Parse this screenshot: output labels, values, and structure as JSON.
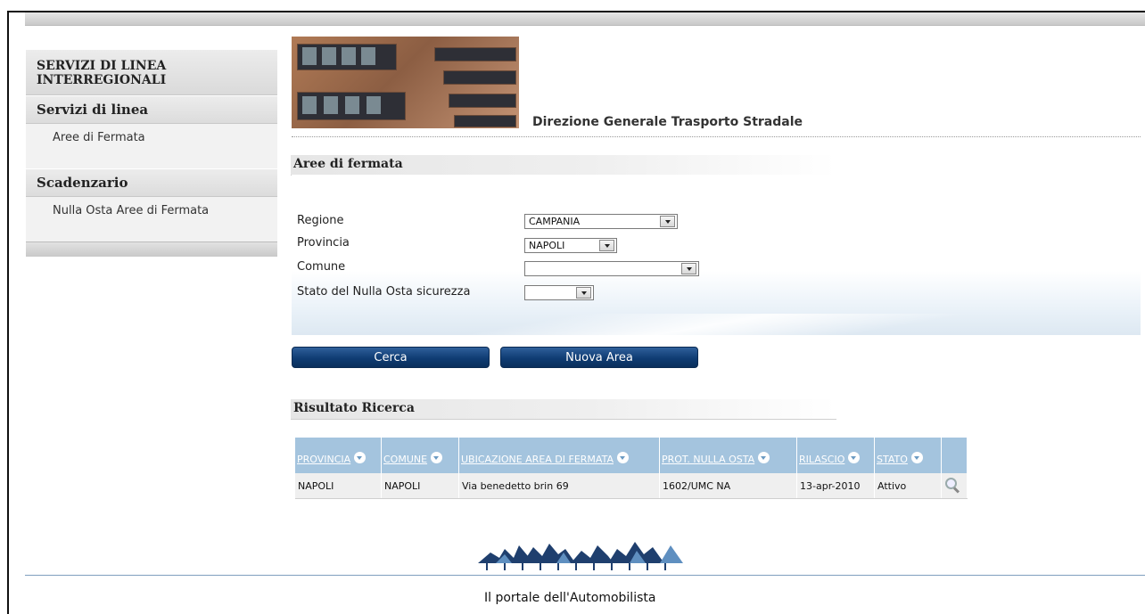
{
  "sidebar": {
    "title": "SERVIZI DI LINEA INTERREGIONALI",
    "sections": [
      {
        "heading": "Servizi di linea",
        "items": [
          "Aree di Fermata"
        ]
      },
      {
        "heading": "Scadenzario",
        "items": [
          "Nulla Osta Aree di Fermata"
        ]
      }
    ]
  },
  "header": {
    "department": "Direzione Generale Trasporto Stradale"
  },
  "search_section": {
    "title": "Aree di fermata"
  },
  "form": {
    "regione_label": "Regione",
    "regione_value": "CAMPANIA",
    "provincia_label": "Provincia",
    "provincia_value": "NAPOLI",
    "comune_label": "Comune",
    "comune_value": "",
    "stato_label": "Stato del Nulla Osta sicurezza",
    "stato_value": ""
  },
  "buttons": {
    "search": "Cerca",
    "new_area": "Nuova Area"
  },
  "results": {
    "title": "Risultato Ricerca",
    "columns": [
      "PROVINCIA",
      "COMUNE",
      "UBICAZIONE AREA DI FERMATA",
      "PROT. NULLA OSTA",
      "RILASCIO",
      "STATO"
    ],
    "rows": [
      [
        "NAPOLI",
        "NAPOLI",
        "Via benedetto brin 69",
        "1602/UMC NA",
        "13-apr-2010",
        "Attivo"
      ]
    ]
  },
  "footer": {
    "text": "Il portale dell'Automobilista"
  },
  "colors": {
    "button_blue": "#0f3c73",
    "table_header": "#a4c4de",
    "footer_line": "#7f9fbf"
  },
  "icons": {
    "sort": "sort-arrow-icon",
    "detail": "magnifier-icon"
  }
}
